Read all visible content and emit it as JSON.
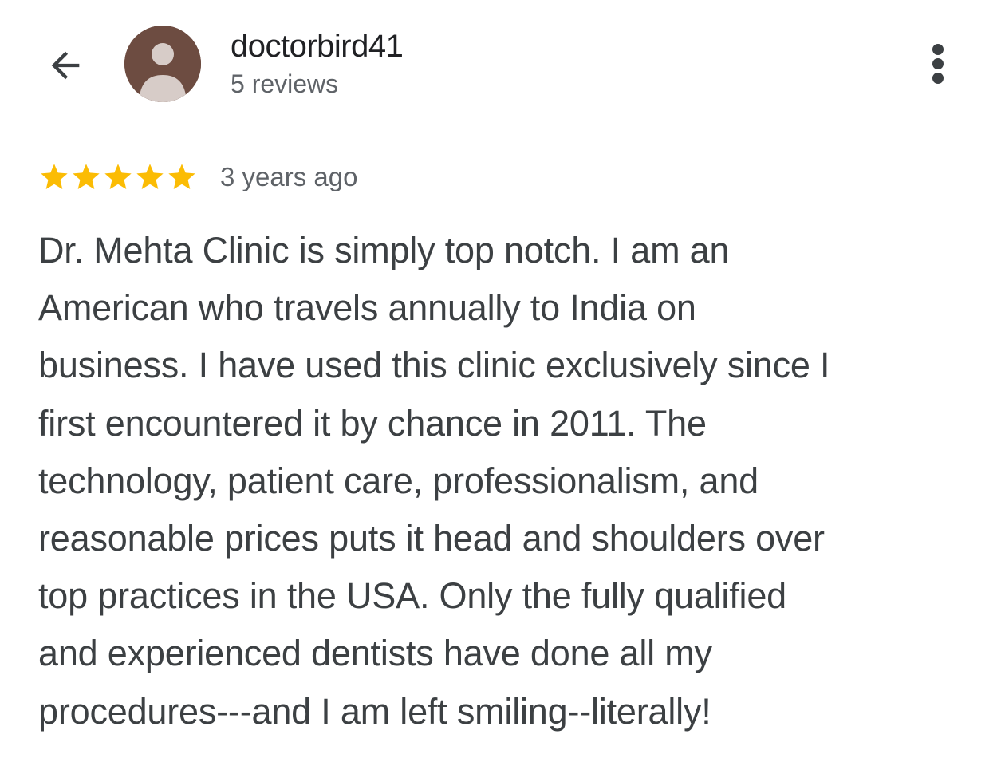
{
  "header": {
    "back_icon": "arrow-left-icon",
    "avatar_icon": "person-avatar-icon",
    "user_name": "doctorbird41",
    "review_count": "5 reviews",
    "more_icon": "more-vert-icon"
  },
  "review": {
    "rating": 5,
    "rating_max": 5,
    "star_color": "#fbbc04",
    "date": "3 years ago",
    "text": "Dr. Mehta Clinic is simply top notch. I am an\nAmerican who travels annually to India on\nbusiness. I have used this clinic exclusively since I\nfirst encountered it by chance in 2011. The\ntechnology, patient care, professionalism, and\nreasonable prices puts it head and shoulders over\ntop practices in the USA. Only the fully qualified\nand experienced dentists have done all my\nprocedures---and I am left smiling--literally!"
  },
  "colors": {
    "avatar_bg": "#6d4c41",
    "avatar_fg": "#d7ccc8",
    "primary_text": "#202124",
    "secondary_text": "#5f6368",
    "body_text": "#3c4043"
  }
}
